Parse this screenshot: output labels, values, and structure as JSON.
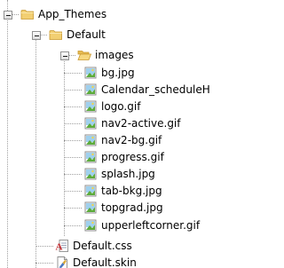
{
  "tree": {
    "app_themes": {
      "label": "App_Themes",
      "icon": "folder-icon"
    },
    "default": {
      "label": "Default",
      "icon": "folder-icon"
    },
    "images": {
      "label": "images",
      "icon": "folder-open-icon"
    },
    "image_files": [
      {
        "label": "bg.jpg"
      },
      {
        "label": "Calendar_scheduleH"
      },
      {
        "label": "logo.gif"
      },
      {
        "label": "nav2-active.gif"
      },
      {
        "label": "nav2-bg.gif"
      },
      {
        "label": "progress.gif"
      },
      {
        "label": "splash.jpg"
      },
      {
        "label": "tab-bkg.jpg"
      },
      {
        "label": "topgrad.jpg"
      },
      {
        "label": "upperleftcorner.gif"
      }
    ],
    "default_css": {
      "label": "Default.css",
      "icon": "css-file-icon"
    },
    "default_skin": {
      "label": "Default.skin",
      "icon": "skin-file-icon"
    }
  },
  "colors": {
    "folder": "#f2cf72",
    "folder_dark": "#d8a93a",
    "line": "#a0a0a0"
  }
}
